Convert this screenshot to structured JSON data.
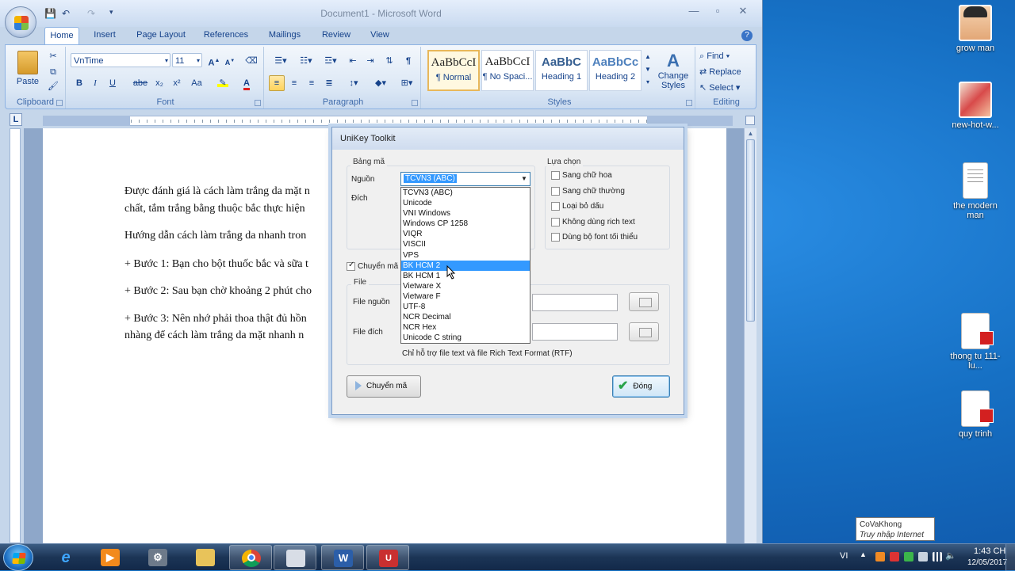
{
  "word": {
    "title": "Document1 - Microsoft Word",
    "qat": [
      "💾",
      "↶",
      "↷",
      "▾"
    ],
    "tabs": [
      "Home",
      "Insert",
      "Page Layout",
      "References",
      "Mailings",
      "Review",
      "View"
    ],
    "clipboard": {
      "paste": "Paste",
      "label": "Clipboard"
    },
    "font": {
      "name": "VnTime",
      "size": "11",
      "label": "Font",
      "buttons": [
        "B",
        "I",
        "U",
        "abe",
        "x₂",
        "x²",
        "Aa"
      ]
    },
    "paragraph": {
      "label": "Paragraph"
    },
    "styles": {
      "label": "Styles",
      "tiles": [
        {
          "sample": "AaBbCcI",
          "name": "¶ Normal"
        },
        {
          "sample": "AaBbCcI",
          "name": "¶ No Spaci..."
        },
        {
          "sample": "AaBbC",
          "name": "Heading 1"
        },
        {
          "sample": "AaBbCc",
          "name": "Heading 2"
        }
      ],
      "change": "Change Styles"
    },
    "editing": {
      "label": "Editing",
      "find": "Find",
      "replace": "Replace",
      "select": "Select"
    },
    "document": {
      "paragraphs": [
        "Được đánh giá là cách làm trắng da mặt n",
        "chất, tắm trắng bằng thuộc bắc thực hiện",
        "Hướng dẫn cách làm trắng da nhanh tron",
        "+ Bước 1: Bạn cho bột thuốc bắc và sữa t",
        "+ Bước 2: Sau bạn chờ khoảng 2 phút cho",
        "+ Bước 3: Nên nhớ phải thoa thật đủ hồn",
        "nhàng để cách làm trắng da mặt nhanh n"
      ]
    }
  },
  "unikey": {
    "title": "UniKey Toolkit",
    "bang_ma": "Bảng mã",
    "nguon": "Nguồn",
    "dich": "Đích",
    "selected": "TCVN3 (ABC)",
    "options": [
      "TCVN3 (ABC)",
      "Unicode",
      "VNI Windows",
      "Windows CP 1258",
      "VIQR",
      "VISCII",
      "VPS",
      "BK HCM 2",
      "BK HCM 1",
      "Vietware X",
      "Vietware F",
      "UTF-8",
      "NCR Decimal",
      "NCR Hex",
      "Unicode C string"
    ],
    "highlighted": "BK HCM 2",
    "lua_chon": "Lựa chọn",
    "checkboxes": [
      "Sang chữ hoa",
      "Sang chữ thường",
      "Loại bỏ dấu",
      "Không dùng rich text",
      "Dùng bộ font tối thiểu"
    ],
    "chuyen_ma_clipboard": "Chuyển mã",
    "file": "File",
    "file_nguon": "File nguồn",
    "file_dich": "File đích",
    "note": "Chỉ hỗ trợ file text và file Rich Text Format (RTF)",
    "btn_convert": "Chuyển mã",
    "btn_close": "Đóng"
  },
  "desktop": {
    "icons": [
      "grow man",
      "new-hot-w...",
      "the modern man",
      "thong tu 111- lu...",
      "quy trinh"
    ]
  },
  "taskbar": {
    "tooltip_line1": "CoVaKhong",
    "tooltip_line2": "Truy nhập Internet",
    "lang": "VI",
    "time": "1:43 CH",
    "date": "12/05/2017"
  }
}
